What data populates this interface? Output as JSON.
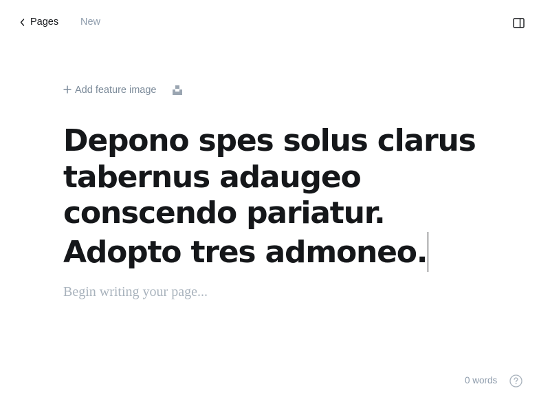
{
  "header": {
    "back_label": "Pages",
    "status": "New",
    "back_icon": "chevron-left-icon",
    "sidebar_icon": "sidebar-panel-icon"
  },
  "editor": {
    "add_feature_image": "Add feature image",
    "add_icon": "plus-icon",
    "unsplash_icon": "unsplash-icon",
    "title": "Depono spes solus clarus tabernus adaugeo conscendo pariatur. Adopto tres admoneo.",
    "body_placeholder": "Begin writing your page..."
  },
  "footer": {
    "word_count": "0 words",
    "help_icon": "help-question-icon"
  },
  "colors": {
    "text": "#15171a",
    "muted": "#8e9cac",
    "placeholder": "#a9b3bd"
  }
}
